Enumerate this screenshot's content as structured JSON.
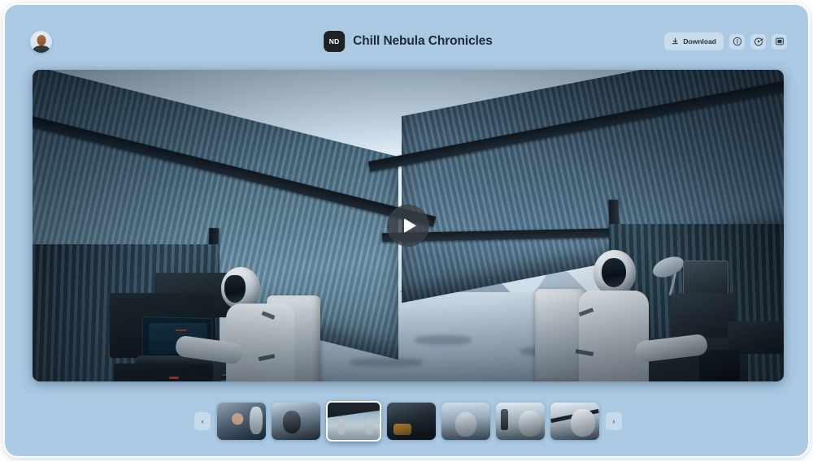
{
  "header": {
    "avatar_name": "user-avatar",
    "logo_text": "ND",
    "title": "Chill Nebula Chronicles",
    "download_label": "Download",
    "icons": {
      "download": "download-icon",
      "info": "info-circle-icon",
      "replay": "replay-circle-icon",
      "panel": "panel-layout-icon"
    }
  },
  "player": {
    "play_label": "▶",
    "scene_description": "Astronauts inside an arctic shelter tent looking out at snow-covered mountains",
    "accent_color": "#ffffff",
    "background_color": "#abc9e2",
    "play_button_color": "#3a4046"
  },
  "filmstrip": {
    "prev_label": "‹",
    "next_label": "›",
    "selected_index": 2,
    "thumbnails": [
      {
        "id": 1,
        "name": "thumb-astronaut-closeup",
        "style": "tb1"
      },
      {
        "id": 2,
        "name": "thumb-explorer-console",
        "style": "tb2"
      },
      {
        "id": 3,
        "name": "thumb-tent-interior-wide",
        "style": "tb3"
      },
      {
        "id": 4,
        "name": "thumb-dark-equipment",
        "style": "tb4"
      },
      {
        "id": 5,
        "name": "thumb-astronaut-back-snow",
        "style": "tb5"
      },
      {
        "id": 6,
        "name": "thumb-astronaut-antenna",
        "style": "tb6"
      },
      {
        "id": 7,
        "name": "thumb-astronaut-profile",
        "style": "tb7"
      }
    ]
  }
}
